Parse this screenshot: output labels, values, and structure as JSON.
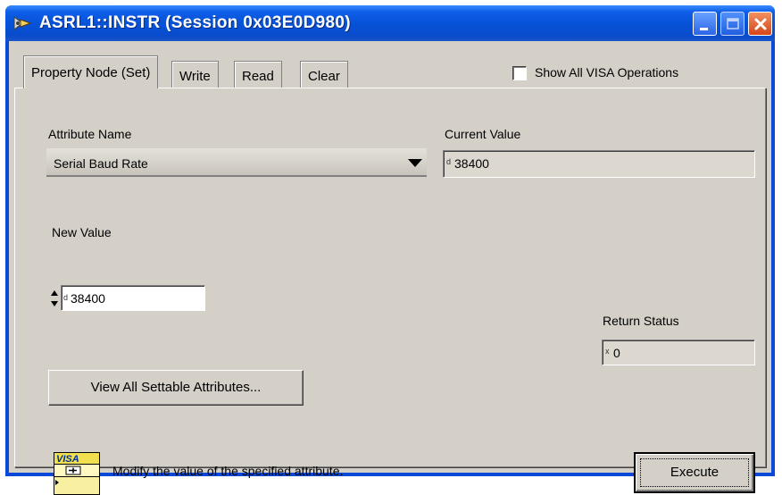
{
  "window": {
    "title": "ASRL1::INSTR (Session 0x03E0D980)",
    "icons": [
      "app-icon",
      "minimize-icon",
      "maximize-icon",
      "close-icon"
    ]
  },
  "tabs": [
    {
      "label": "Property Node (Set)",
      "active": true
    },
    {
      "label": "Write",
      "active": false
    },
    {
      "label": "Read",
      "active": false
    },
    {
      "label": "Clear",
      "active": false
    }
  ],
  "show_all": {
    "label": "Show All VISA Operations",
    "checked": false
  },
  "attribute": {
    "label": "Attribute Name",
    "selected": "Serial Baud Rate"
  },
  "current_value": {
    "label": "Current Value",
    "radix": "d",
    "value": "38400"
  },
  "new_value": {
    "label": "New Value",
    "radix": "d",
    "value": "38400"
  },
  "return_status": {
    "label": "Return Status",
    "radix": "x",
    "value": "0"
  },
  "buttons": {
    "view_all": "View All Settable Attributes...",
    "execute": "Execute"
  },
  "visa_icon": {
    "label": "VISA"
  },
  "description": "Modify the value of the specified attribute.",
  "colors": {
    "titlebar": "#0653d8",
    "dialog_face": "#d4d0c8",
    "close_button": "#d6451a"
  }
}
